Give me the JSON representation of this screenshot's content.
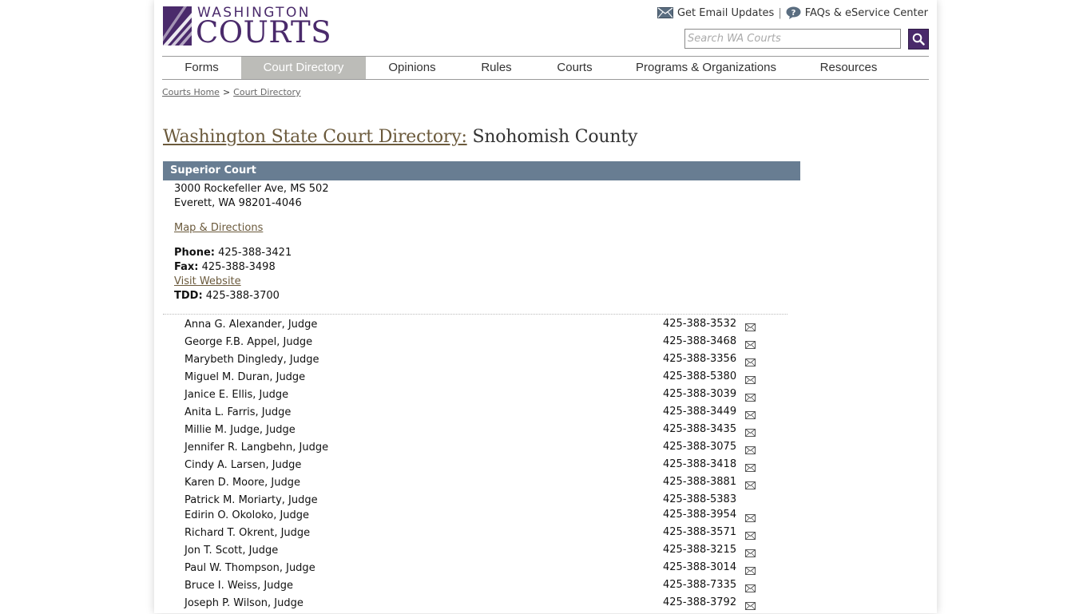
{
  "header": {
    "logo_top": "WASHINGTON",
    "logo_bottom": "COURTS",
    "email_updates": "Get Email Updates",
    "separator": "|",
    "faqs": "FAQs & eService Center",
    "search_placeholder": "Search WA Courts"
  },
  "nav": {
    "items": [
      {
        "label": "Forms"
      },
      {
        "label": "Court Directory",
        "active": true
      },
      {
        "label": "Opinions"
      },
      {
        "label": "Rules"
      },
      {
        "label": "Courts"
      },
      {
        "label": "Programs & Organizations"
      },
      {
        "label": "Resources"
      }
    ]
  },
  "breadcrumb": {
    "home": "Courts Home",
    "separator": ">",
    "current": "Court Directory"
  },
  "page": {
    "title_link": "Washington State Court Directory:",
    "title_rest": " Snohomish County"
  },
  "court": {
    "name": "Superior Court",
    "address1": "3000 Rockefeller Ave, MS 502",
    "address2": "Everett, WA 98201-4046",
    "map_link": "Map & Directions",
    "phone_label": "Phone:",
    "phone": " 425-388-3421",
    "fax_label": "Fax:",
    "fax": " 425-388-3498",
    "website_link": "Visit Website",
    "tdd_label": "TDD:",
    "tdd": " 425-388-3700"
  },
  "judges": [
    {
      "name": "Anna G. Alexander, Judge",
      "phone": "425-388-3532",
      "email": true
    },
    {
      "name": "George F.B. Appel, Judge",
      "phone": "425-388-3468",
      "email": true
    },
    {
      "name": "Marybeth Dingledy, Judge",
      "phone": "425-388-3356",
      "email": true
    },
    {
      "name": "Miguel M. Duran, Judge",
      "phone": "425-388-5380",
      "email": true
    },
    {
      "name": "Janice E. Ellis, Judge",
      "phone": "425-388-3039",
      "email": true
    },
    {
      "name": "Anita L. Farris, Judge",
      "phone": "425-388-3449",
      "email": true
    },
    {
      "name": "Millie M. Judge, Judge",
      "phone": "425-388-3435",
      "email": true
    },
    {
      "name": "Jennifer R. Langbehn, Judge",
      "phone": "425-388-3075",
      "email": true
    },
    {
      "name": "Cindy A. Larsen, Judge",
      "phone": "425-388-3418",
      "email": true
    },
    {
      "name": "Karen D. Moore, Judge",
      "phone": "425-388-3881",
      "email": true
    },
    {
      "name": "Patrick M. Moriarty, Judge",
      "phone": "425-388-5383",
      "email": false
    },
    {
      "name": "Edirin O. Okoloko, Judge",
      "phone": "425-388-3954",
      "email": true
    },
    {
      "name": "Richard T. Okrent, Judge",
      "phone": "425-388-3571",
      "email": true
    },
    {
      "name": "Jon T. Scott, Judge",
      "phone": "425-388-3215",
      "email": true
    },
    {
      "name": "Paul W. Thompson, Judge",
      "phone": "425-388-3014",
      "email": true
    },
    {
      "name": "Bruce I. Weiss, Judge",
      "phone": "425-388-7335",
      "email": true
    },
    {
      "name": "Joseph P. Wilson, Judge",
      "phone": "425-388-3792",
      "email": true
    }
  ],
  "colors": {
    "brand_purple": "#4a2a6b",
    "court_header": "#687d92",
    "nav_active": "#bcbcb8",
    "link": "#6b5a3c"
  }
}
